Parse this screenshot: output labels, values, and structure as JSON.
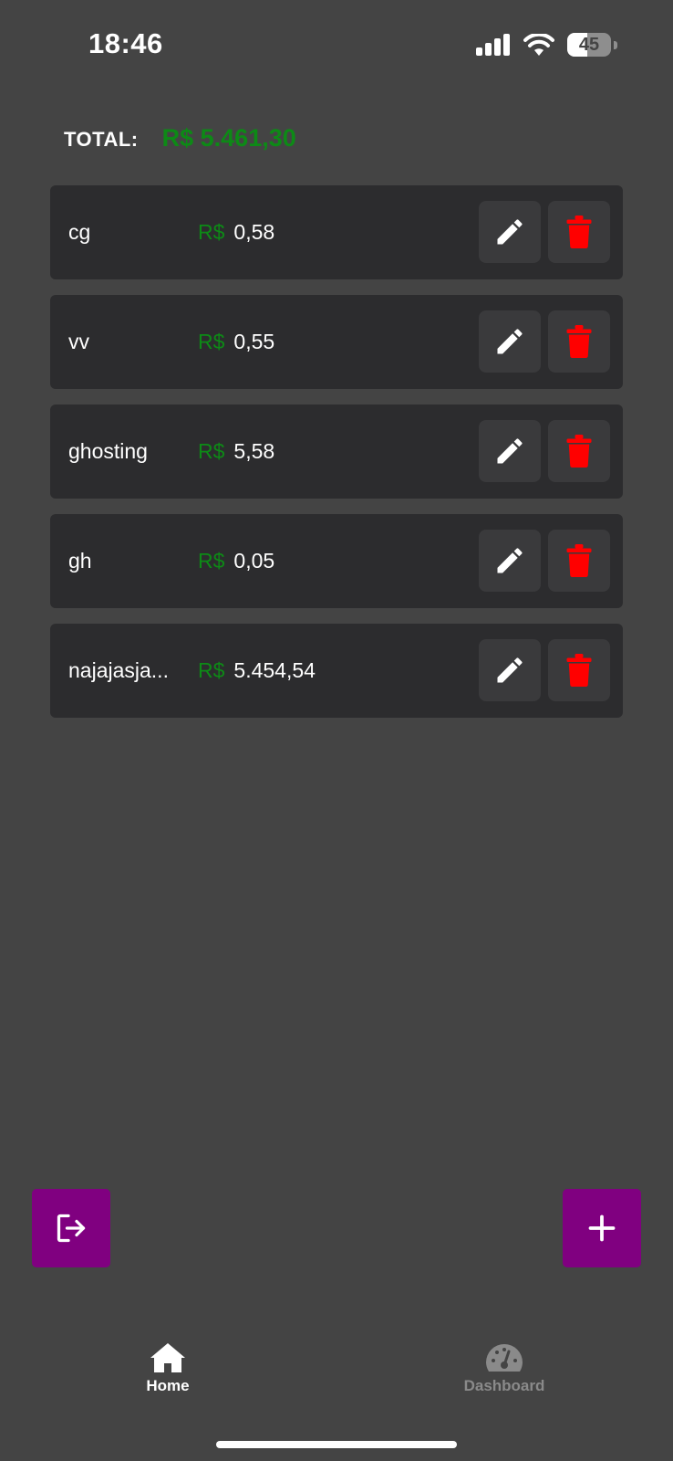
{
  "status_bar": {
    "time": "18:46",
    "battery_level": "45",
    "battery_fraction": 0.45,
    "icons": [
      "signal-icon",
      "wifi-icon",
      "battery-icon"
    ]
  },
  "total": {
    "label": "TOTAL:",
    "value": "R$ 5.461,30"
  },
  "items": [
    {
      "name": "cg",
      "currency": "R$",
      "amount": "0,58"
    },
    {
      "name": "vv",
      "currency": "R$",
      "amount": "0,55"
    },
    {
      "name": "ghosting",
      "currency": "R$",
      "amount": "5,58"
    },
    {
      "name": "gh",
      "currency": "R$",
      "amount": "0,05"
    },
    {
      "name": "najajasja...",
      "currency": "R$",
      "amount": "5.454,54"
    }
  ],
  "item_actions": {
    "edit_icon": "pencil-icon",
    "delete_icon": "trash-icon"
  },
  "fabs": {
    "logout_icon": "logout-icon",
    "add_icon": "plus-icon"
  },
  "bottom_nav": {
    "home_label": "Home",
    "dashboard_label": "Dashboard",
    "active": "Home"
  },
  "colors": {
    "background": "#444444",
    "card": "#2c2c2e",
    "button": "#3a3a3c",
    "accent_green": "#0d8a16",
    "delete_red": "#ff0000",
    "fab_purple": "#800080",
    "inactive_nav": "#8a8a8a"
  }
}
